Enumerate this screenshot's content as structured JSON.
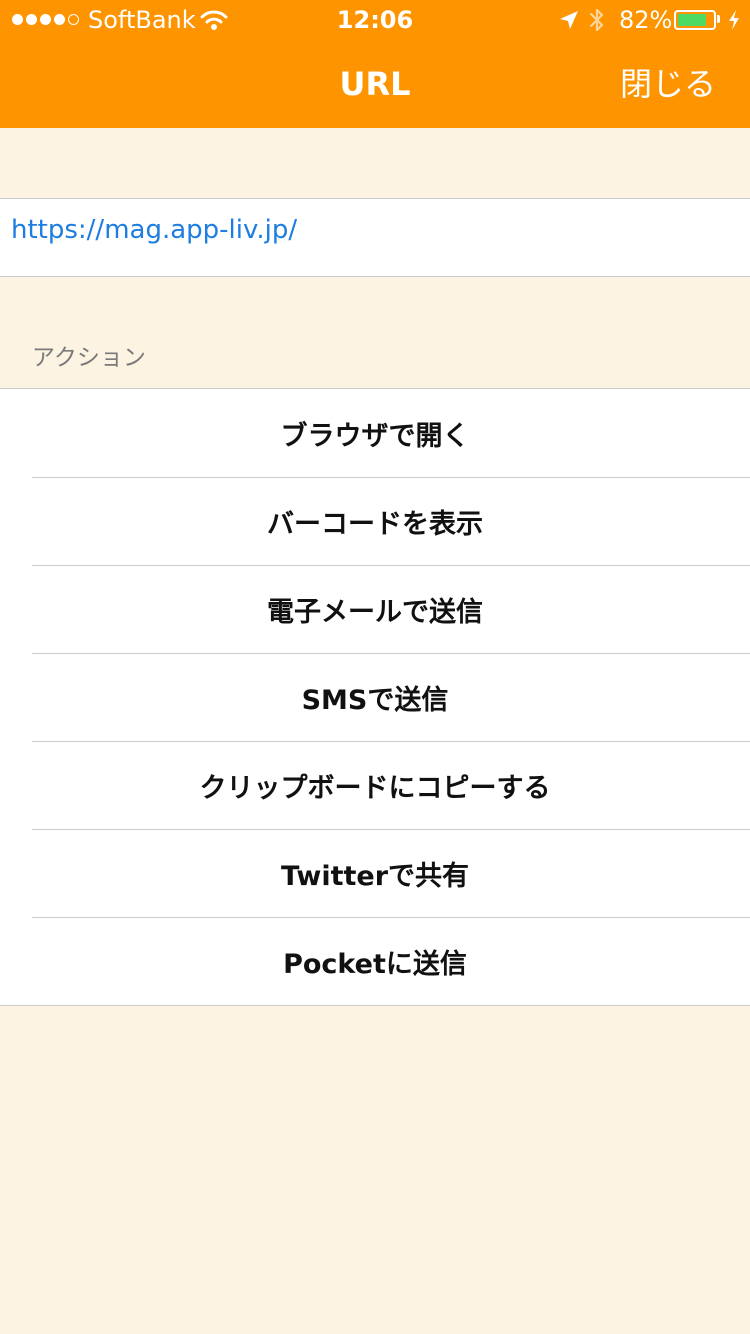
{
  "status_bar": {
    "carrier": "SoftBank",
    "time": "12:06",
    "battery_percent": "82%",
    "battery_level": 0.82,
    "signal_bars": 4,
    "signal_total": 5,
    "icons": [
      "wifi-icon",
      "location-arrow-icon",
      "bluetooth-icon",
      "battery-icon",
      "charging-icon"
    ]
  },
  "nav": {
    "title": "URL",
    "close_label": "閉じる"
  },
  "url": {
    "value": "https://mag.app-liv.jp/"
  },
  "actions": {
    "header": "アクション",
    "items": [
      {
        "label": "ブラウザで開く"
      },
      {
        "label": "バーコードを表示"
      },
      {
        "label": "電子メールで送信"
      },
      {
        "label": "SMSで送信"
      },
      {
        "label": "クリップボードにコピーする"
      },
      {
        "label": "Twitterで共有"
      },
      {
        "label": "Pocketに送信"
      }
    ]
  },
  "colors": {
    "nav_bar": "#fe9400",
    "background": "#fdf3e2",
    "link": "#1e7de0",
    "battery_fill": "#4cd964"
  }
}
